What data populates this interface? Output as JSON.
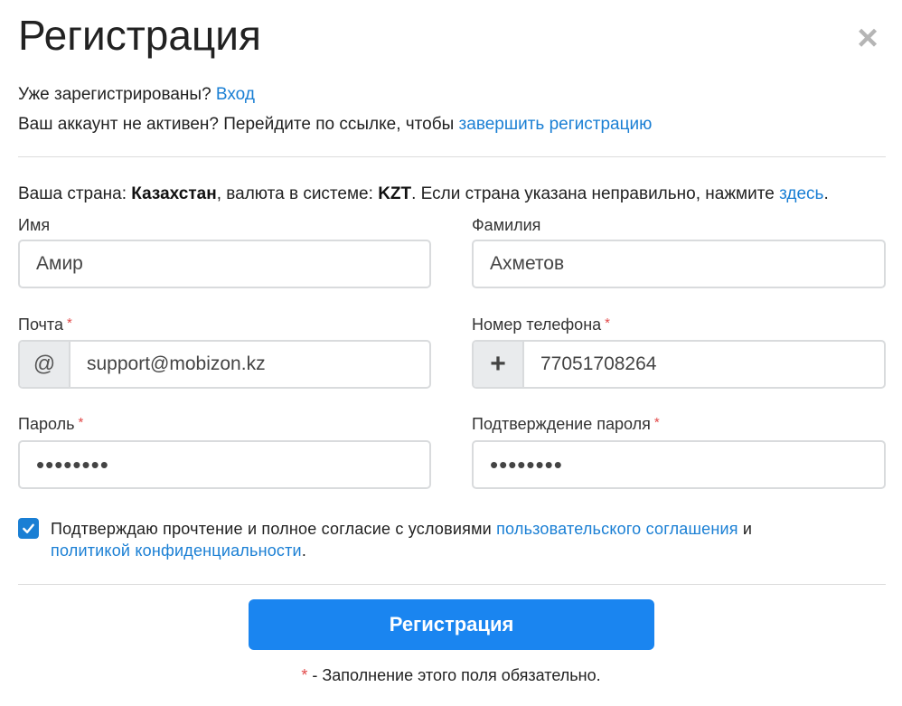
{
  "title": "Регистрация",
  "close_symbol": "×",
  "already": {
    "text": "Уже зарегистрированы? ",
    "link": "Вход"
  },
  "inactive": {
    "text": "Ваш аккаунт не активен? Перейдите по ссылке, чтобы ",
    "link": "завершить регистрацию"
  },
  "country": {
    "prefix": "Ваша страна: ",
    "country_name": "Казахстан",
    "middle": ", валюта в системе: ",
    "currency": "KZT",
    "suffix": ". Если страна указана неправильно, нажмите ",
    "link": "здесь",
    "end": "."
  },
  "fields": {
    "first_name": {
      "label": "Имя",
      "value": "Амир",
      "required": false
    },
    "last_name": {
      "label": "Фамилия",
      "value": "Ахметов",
      "required": false
    },
    "email": {
      "label": "Почта",
      "value": "support@mobizon.kz",
      "addon": "@",
      "required": true
    },
    "phone": {
      "label": "Номер телефона",
      "value": "77051708264",
      "addon": "+",
      "required": true
    },
    "password": {
      "label": "Пароль",
      "value": "secret12",
      "required": true
    },
    "password_confirm": {
      "label": "Подтверждение пароля",
      "value": "secret12",
      "required": true
    }
  },
  "required_mark": "*",
  "agreement": {
    "checked": true,
    "text": "Подтверждаю прочтение и полное согласие с условиями ",
    "link1": "пользовательского соглашения",
    "and": " и ",
    "link2": "политикой конфиденциальности",
    "end": "."
  },
  "submit_label": "Регистрация",
  "footnote": {
    "star": "*",
    "text": " - Заполнение этого поля обязательно."
  },
  "colors": {
    "accent": "#1a85f0",
    "link": "#1a7fd4",
    "required": "#e24a4a"
  },
  "icons": {
    "close": "close-icon",
    "check": "checkmark-icon",
    "email_addon": "at-icon",
    "phone_addon": "plus-icon"
  }
}
